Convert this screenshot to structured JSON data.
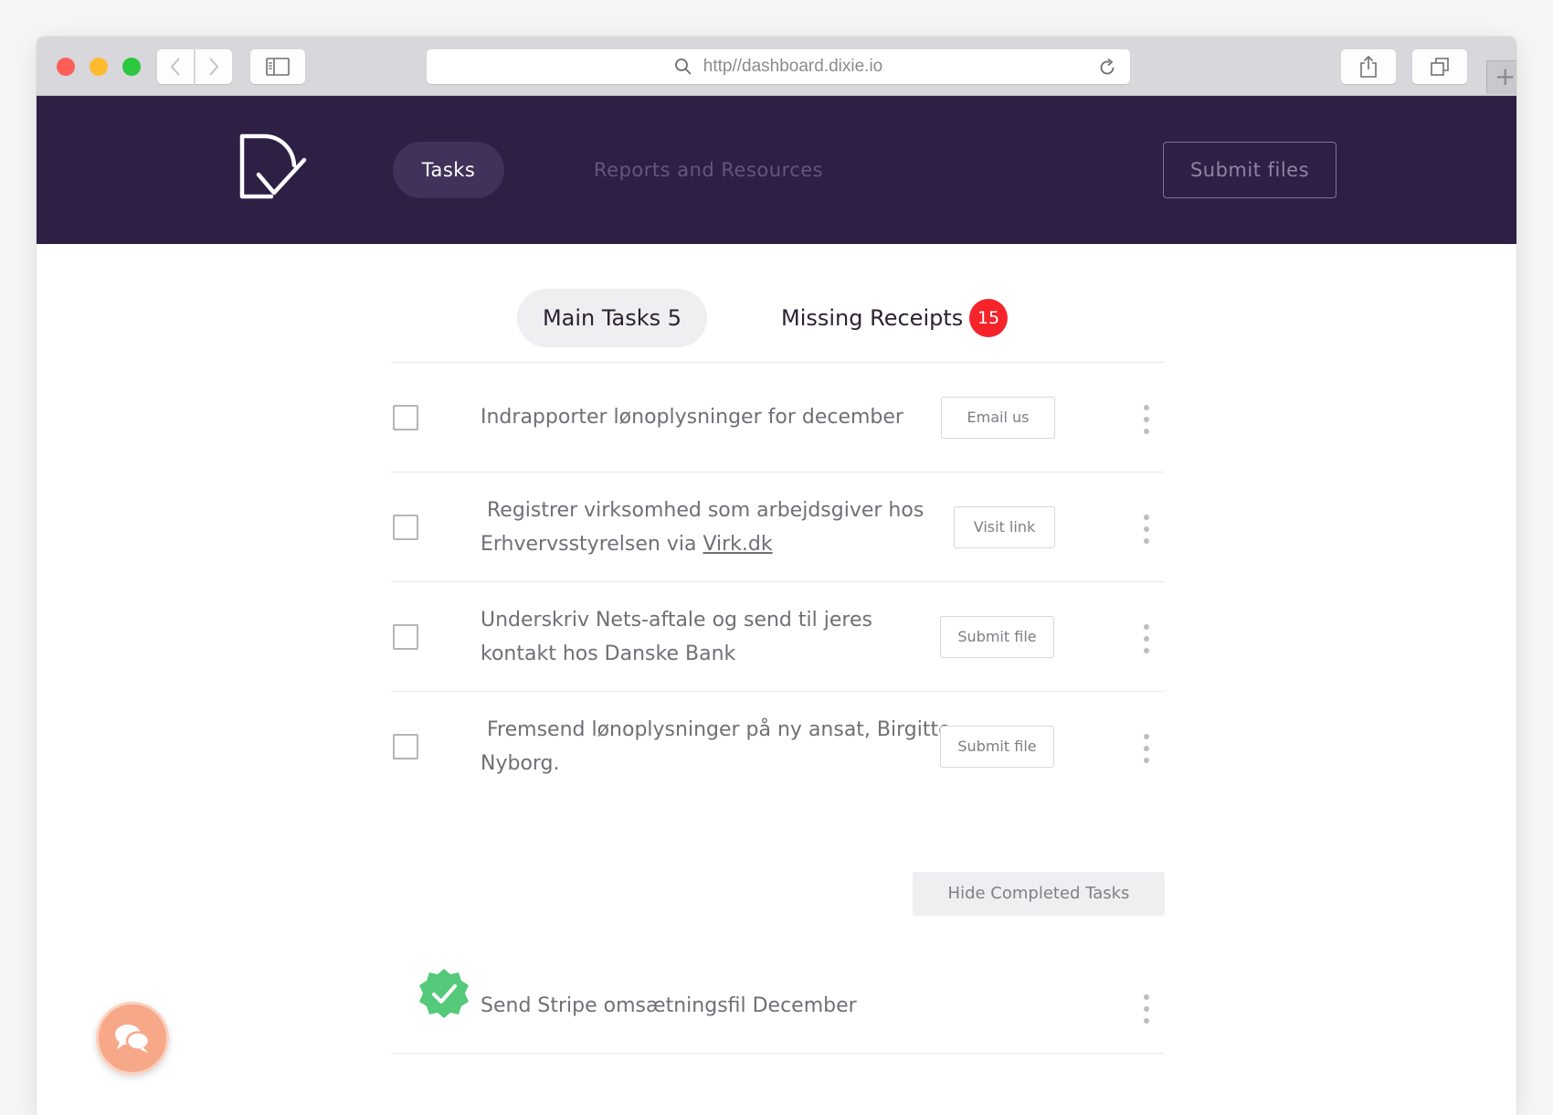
{
  "browser": {
    "url": "http//dashboard.dixie.io",
    "icons": [
      "back-icon",
      "forward-icon",
      "sidebar-icon",
      "search-icon",
      "reload-icon",
      "share-icon",
      "tabs-icon",
      "plus-icon"
    ]
  },
  "header": {
    "nav_tasks": "Tasks",
    "nav_reports": "Reports and Resources",
    "submit_files": "Submit files",
    "logo_icon": "dixie-logo-icon",
    "background_color": "#2e1f45"
  },
  "tabs": {
    "main": "Main Tasks 5",
    "missing": "Missing Receipts",
    "missing_count": "15",
    "badge_color": "#f5242b"
  },
  "tasks": [
    {
      "text": "Indrapporter lønoplysninger for december",
      "action": "Email us"
    },
    {
      "text_line1": " Registrer virksomhed som arbejdsgiver hos",
      "text_prefix": "Erhvervsstyrelsen via ",
      "link": "Virk.dk",
      "action": "Visit link"
    },
    {
      "text_line1": "Underskriv Nets-aftale og send til jeres",
      "text_line2": "kontakt hos Danske Bank",
      "action": "Submit file"
    },
    {
      "text_line1": " Fremsend lønoplysninger på ny ansat, Birgitte",
      "text_line2": "Nyborg.",
      "action": "Submit file"
    }
  ],
  "hide_completed": "Hide Completed Tasks",
  "completed": [
    {
      "text": "Send Stripe omsætningsfil December",
      "icon": "check-badge-icon",
      "color": "#55c97a"
    }
  ],
  "chat": {
    "icon": "chat-icon",
    "color": "#f7a889"
  }
}
